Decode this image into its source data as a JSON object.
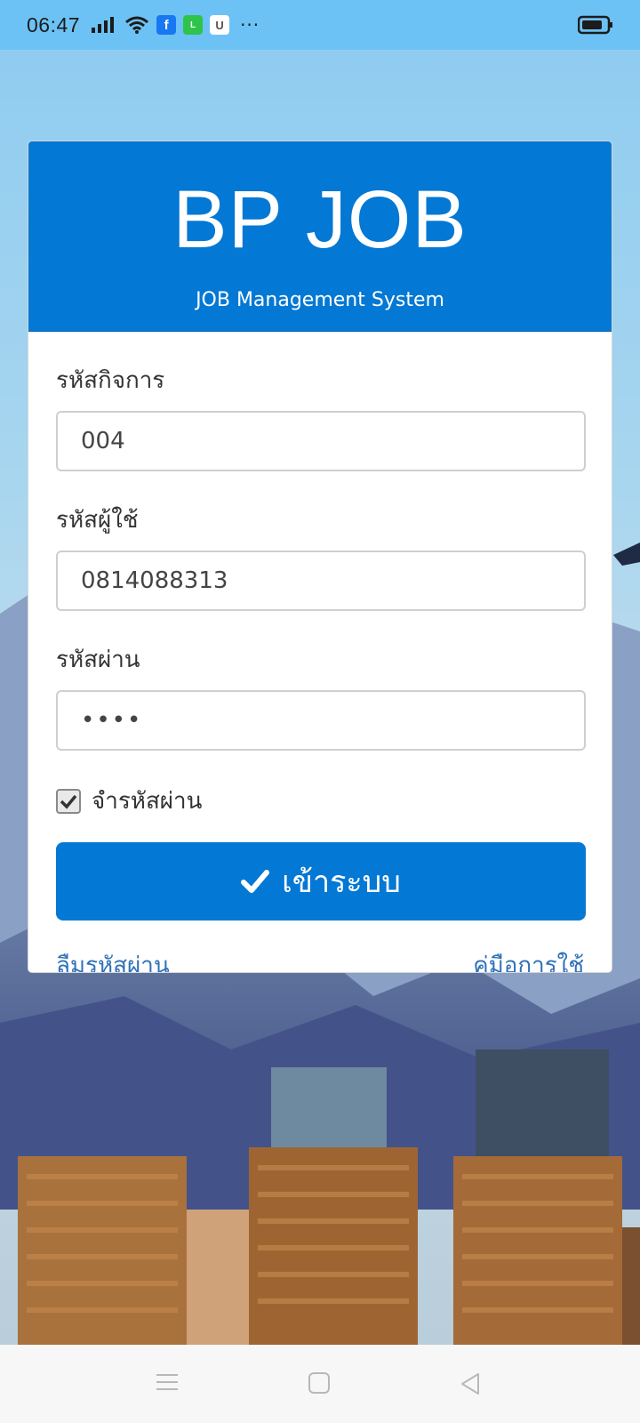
{
  "status_bar": {
    "time": "06:47",
    "icons": [
      "signal-icon",
      "wifi-icon",
      "facebook-icon",
      "line-icon",
      "u-app-icon",
      "more-dots-icon",
      "battery-icon"
    ],
    "more": "···"
  },
  "header": {
    "title": "BP JOB",
    "subtitle": "JOB Management System",
    "color": "#0378d4"
  },
  "form": {
    "business_code_label": "รหัสกิจการ",
    "business_code_value": "004",
    "username_label": "รหัสผู้ใช้",
    "username_value": "0814088313",
    "password_label": "รหัสผ่าน",
    "password_value": "••••",
    "remember_label": "จำรหัสผ่าน",
    "remember_checked": true,
    "login_label": "เข้าระบบ"
  },
  "links": {
    "forgot_password": "ลืมรหัสผ่าน",
    "user_manual": "คู่มือการใช้"
  },
  "nav_bar": {
    "icons": [
      "menu-icon",
      "home-square-icon",
      "back-triangle-icon"
    ]
  }
}
